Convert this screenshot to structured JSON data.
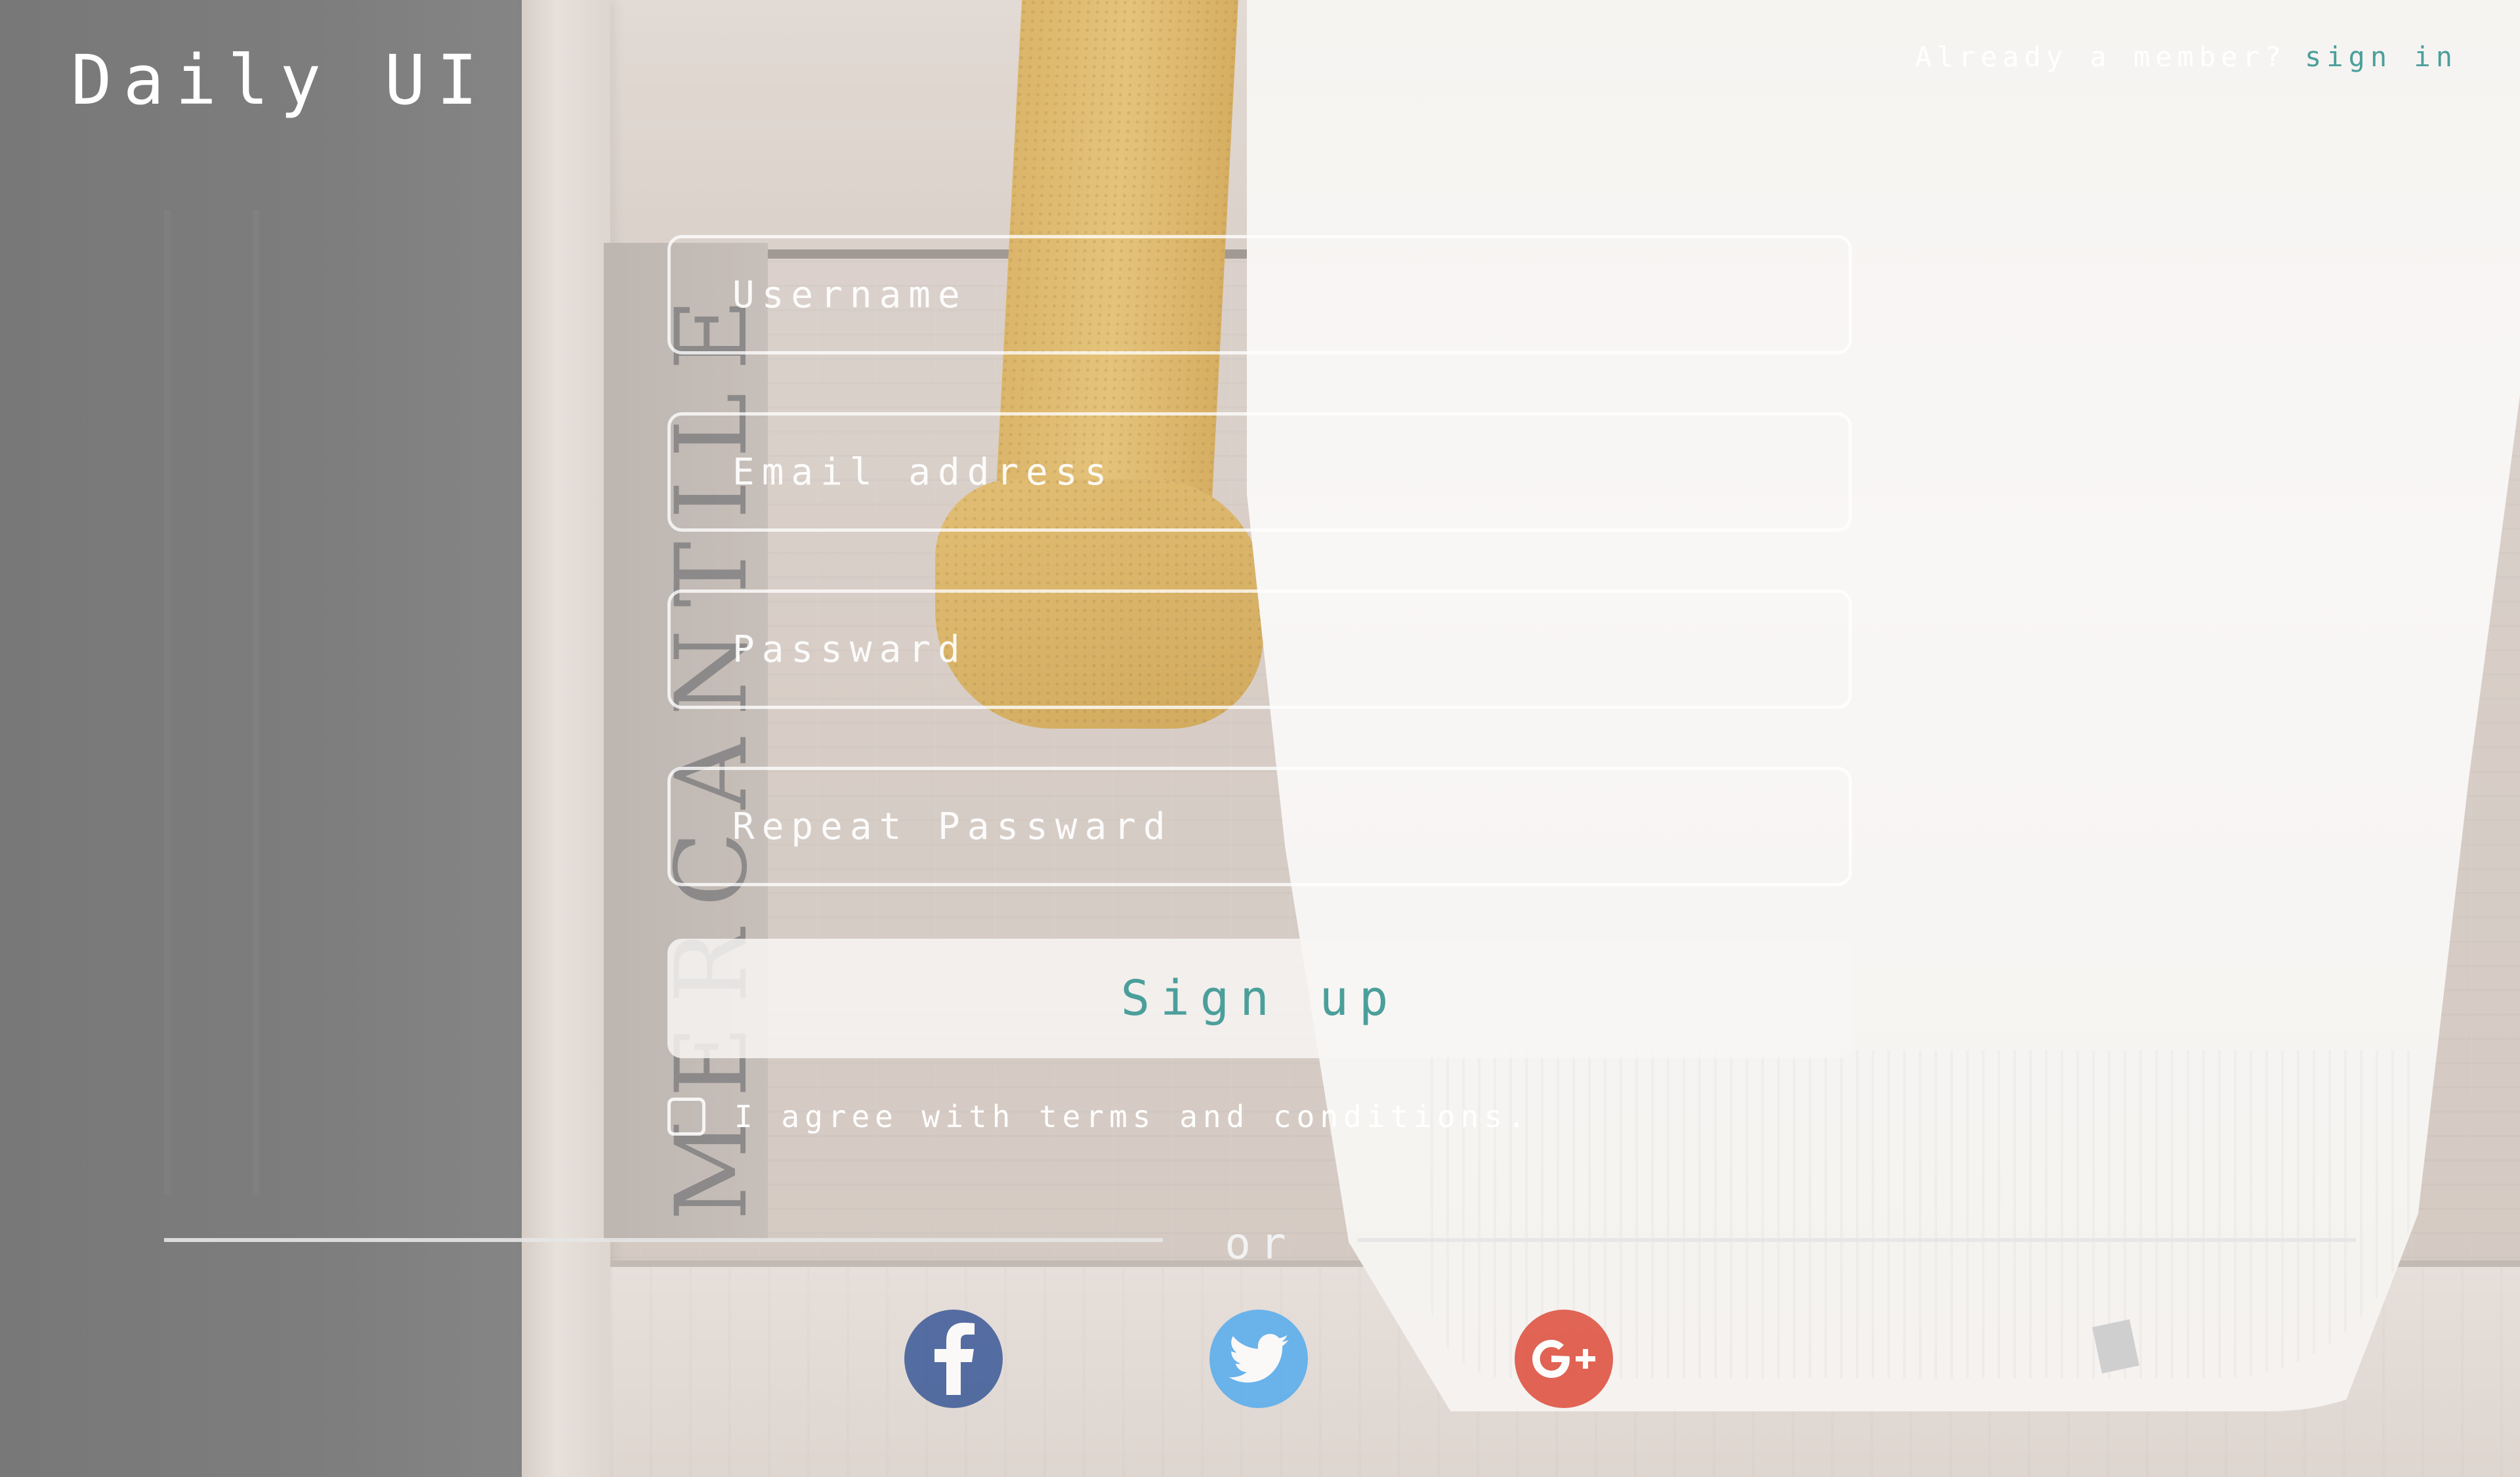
{
  "brand": {
    "title": "Daily UI"
  },
  "header": {
    "member_prompt": "Already a member?",
    "signin_label": "sign in"
  },
  "background": {
    "stencil_text": "MERCANTILE"
  },
  "form": {
    "username_placeholder": "Username",
    "email_placeholder": "Email address",
    "password_placeholder": "Passward",
    "repeat_password_placeholder": "Repeat Passward",
    "signup_label": "Sign up",
    "terms_label": "I agree with terms and conditions.",
    "terms_checked": false
  },
  "divider": {
    "label": "or"
  },
  "social": [
    {
      "name": "facebook-icon",
      "color": "#3b5998"
    },
    {
      "name": "twitter-icon",
      "color": "#55acee"
    },
    {
      "name": "google-plus-icon",
      "color": "#dd4b39"
    }
  ],
  "colors": {
    "accent": "#4b9f9b",
    "text": "#ffffff"
  }
}
